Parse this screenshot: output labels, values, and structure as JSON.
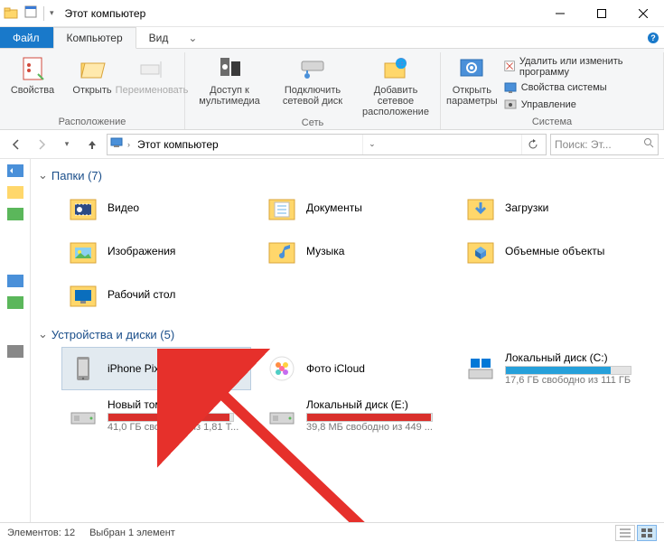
{
  "window": {
    "title": "Этот компьютер"
  },
  "tabs": {
    "file": "Файл",
    "computer": "Компьютер",
    "view": "Вид"
  },
  "ribbon": {
    "group_location": "Расположение",
    "properties": "Свойства",
    "open": "Открыть",
    "rename": "Переименовать",
    "group_network": "Сеть",
    "media_access": "Доступ к мультимедиа",
    "map_drive": "Подключить сетевой диск",
    "add_network": "Добавить сетевое расположение",
    "group_system": "Система",
    "open_params": "Открыть параметры",
    "uninstall": "Удалить или изменить программу",
    "sys_props": "Свойства системы",
    "manage": "Управление"
  },
  "addressbar": {
    "path": "Этот компьютер",
    "search_placeholder": "Поиск: Эт..."
  },
  "groups": {
    "folders": {
      "title": "Папки (7)"
    },
    "devices": {
      "title": "Устройства и диски (5)"
    }
  },
  "folders": [
    {
      "label": "Видео"
    },
    {
      "label": "Документы"
    },
    {
      "label": "Загрузки"
    },
    {
      "label": "Изображения"
    },
    {
      "label": "Музыка"
    },
    {
      "label": "Объемные объекты"
    },
    {
      "label": "Рабочий стол"
    }
  ],
  "devices": [
    {
      "label": "iPhone Pixel",
      "selected": true
    },
    {
      "label": "Фото iCloud"
    },
    {
      "label": "Локальный диск (C:)",
      "sub": "17,6 ГБ свободно из 111 ГБ",
      "fill": 0.84,
      "color": "#26a0da"
    },
    {
      "label": "Новый том (D:)",
      "sub": "41,0 ГБ свободно из 1,81 Т...",
      "fill": 0.97,
      "color": "#d9302c"
    },
    {
      "label": "Локальный диск (E:)",
      "sub": "39,8 МБ свободно из 449 ...",
      "fill": 0.99,
      "color": "#d9302c"
    }
  ],
  "status": {
    "items": "Элементов: 12",
    "selected": "Выбран 1 элемент"
  }
}
